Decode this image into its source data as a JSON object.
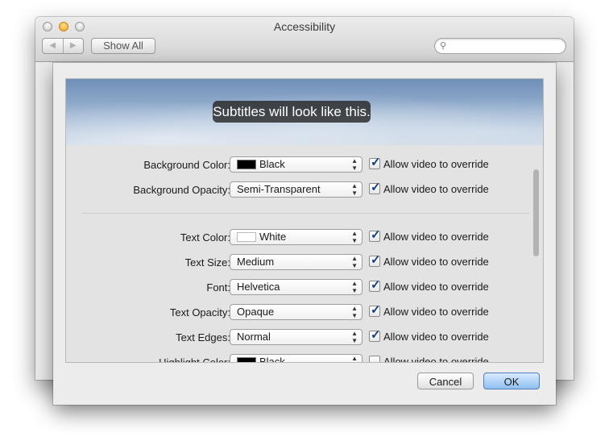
{
  "window": {
    "title": "Accessibility"
  },
  "toolbar": {
    "back_label": "◀",
    "forward_label": "▶",
    "show_all_label": "Show All",
    "search_placeholder": ""
  },
  "preview": {
    "subtitle_text": "Subtitles will look like this."
  },
  "settings": {
    "background_color": {
      "label": "Background Color:",
      "value": "Black",
      "swatch": "#000000",
      "override_label": "Allow video to override",
      "override_checked": true
    },
    "background_opacity": {
      "label": "Background Opacity:",
      "value": "Semi-Transparent",
      "override_label": "Allow video to override",
      "override_checked": true
    },
    "text_color": {
      "label": "Text Color:",
      "value": "White",
      "swatch": "#ffffff",
      "override_label": "Allow video to override",
      "override_checked": true
    },
    "text_size": {
      "label": "Text Size:",
      "value": "Medium",
      "override_label": "Allow video to override",
      "override_checked": true
    },
    "font": {
      "label": "Font:",
      "value": "Helvetica",
      "override_label": "Allow video to override",
      "override_checked": true
    },
    "text_opacity": {
      "label": "Text Opacity:",
      "value": "Opaque",
      "override_label": "Allow video to override",
      "override_checked": true
    },
    "text_edges": {
      "label": "Text Edges:",
      "value": "Normal",
      "override_label": "Allow video to override",
      "override_checked": true
    },
    "highlight_color": {
      "label": "Highlight Color:",
      "value": "Black",
      "swatch": "#000000",
      "override_label": "Allow video to override",
      "override_checked": false
    }
  },
  "buttons": {
    "cancel_label": "Cancel",
    "ok_label": "OK"
  },
  "colors": {
    "ok_button": "#8fbff0",
    "checkmark": "#0f3d8a"
  }
}
